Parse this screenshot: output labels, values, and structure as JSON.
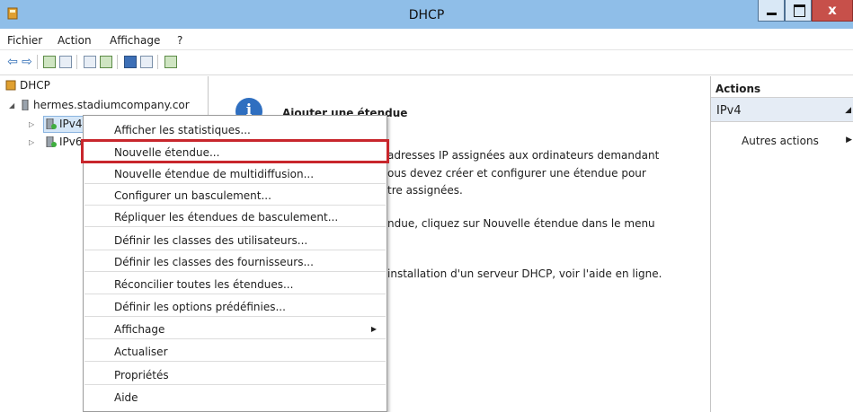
{
  "window": {
    "title": "DHCP",
    "close_symbol": "x"
  },
  "menu": [
    "Fichier",
    "Action",
    "Affichage",
    "?"
  ],
  "toolbar": {
    "icons": [
      "back-icon",
      "forward-icon",
      "folder-up-icon",
      "console-tree-icon",
      "export-icon",
      "refresh-icon",
      "help-icon",
      "properties-icon",
      "computer-icon"
    ],
    "back_glyph": "⇦",
    "forward_glyph": "⇨"
  },
  "tree": {
    "root": "DHCP",
    "server": "hermes.stadiumcompany.cor",
    "ipv4": "IPv4",
    "ipv6": "IPv6",
    "expand_glyph": "▷",
    "collapse_glyph": "◢"
  },
  "center": {
    "title": "Ajouter une étendue",
    "lines": [
      "adresses IP assignées aux ordinateurs demandant",
      "ous devez créer et configurer une étendue pour",
      "tre assignées.",
      "ndue, cliquez sur Nouvelle étendue dans le menu",
      "installation d'un serveur DHCP, voir l'aide en ligne."
    ],
    "info_glyph": "i"
  },
  "actions": {
    "header": "Actions",
    "section": "IPv4",
    "item": "Autres actions",
    "collapse_glyph": "◢",
    "more_glyph": "▶"
  },
  "context_menu": {
    "items": [
      "Afficher les statistiques...",
      "Nouvelle étendue...",
      "Nouvelle étendue de multidiffusion...",
      "Configurer un basculement...",
      "Répliquer les étendues de basculement...",
      "Définir les classes des utilisateurs...",
      "Définir les classes des fournisseurs...",
      "Réconcilier toutes les étendues...",
      "Définir les options prédéfinies...",
      "Affichage",
      "Actualiser",
      "Propriétés",
      "Aide"
    ],
    "submenu_glyph": "▶",
    "highlighted_item": "Nouvelle étendue...",
    "highlight_color": "#c8262c"
  }
}
